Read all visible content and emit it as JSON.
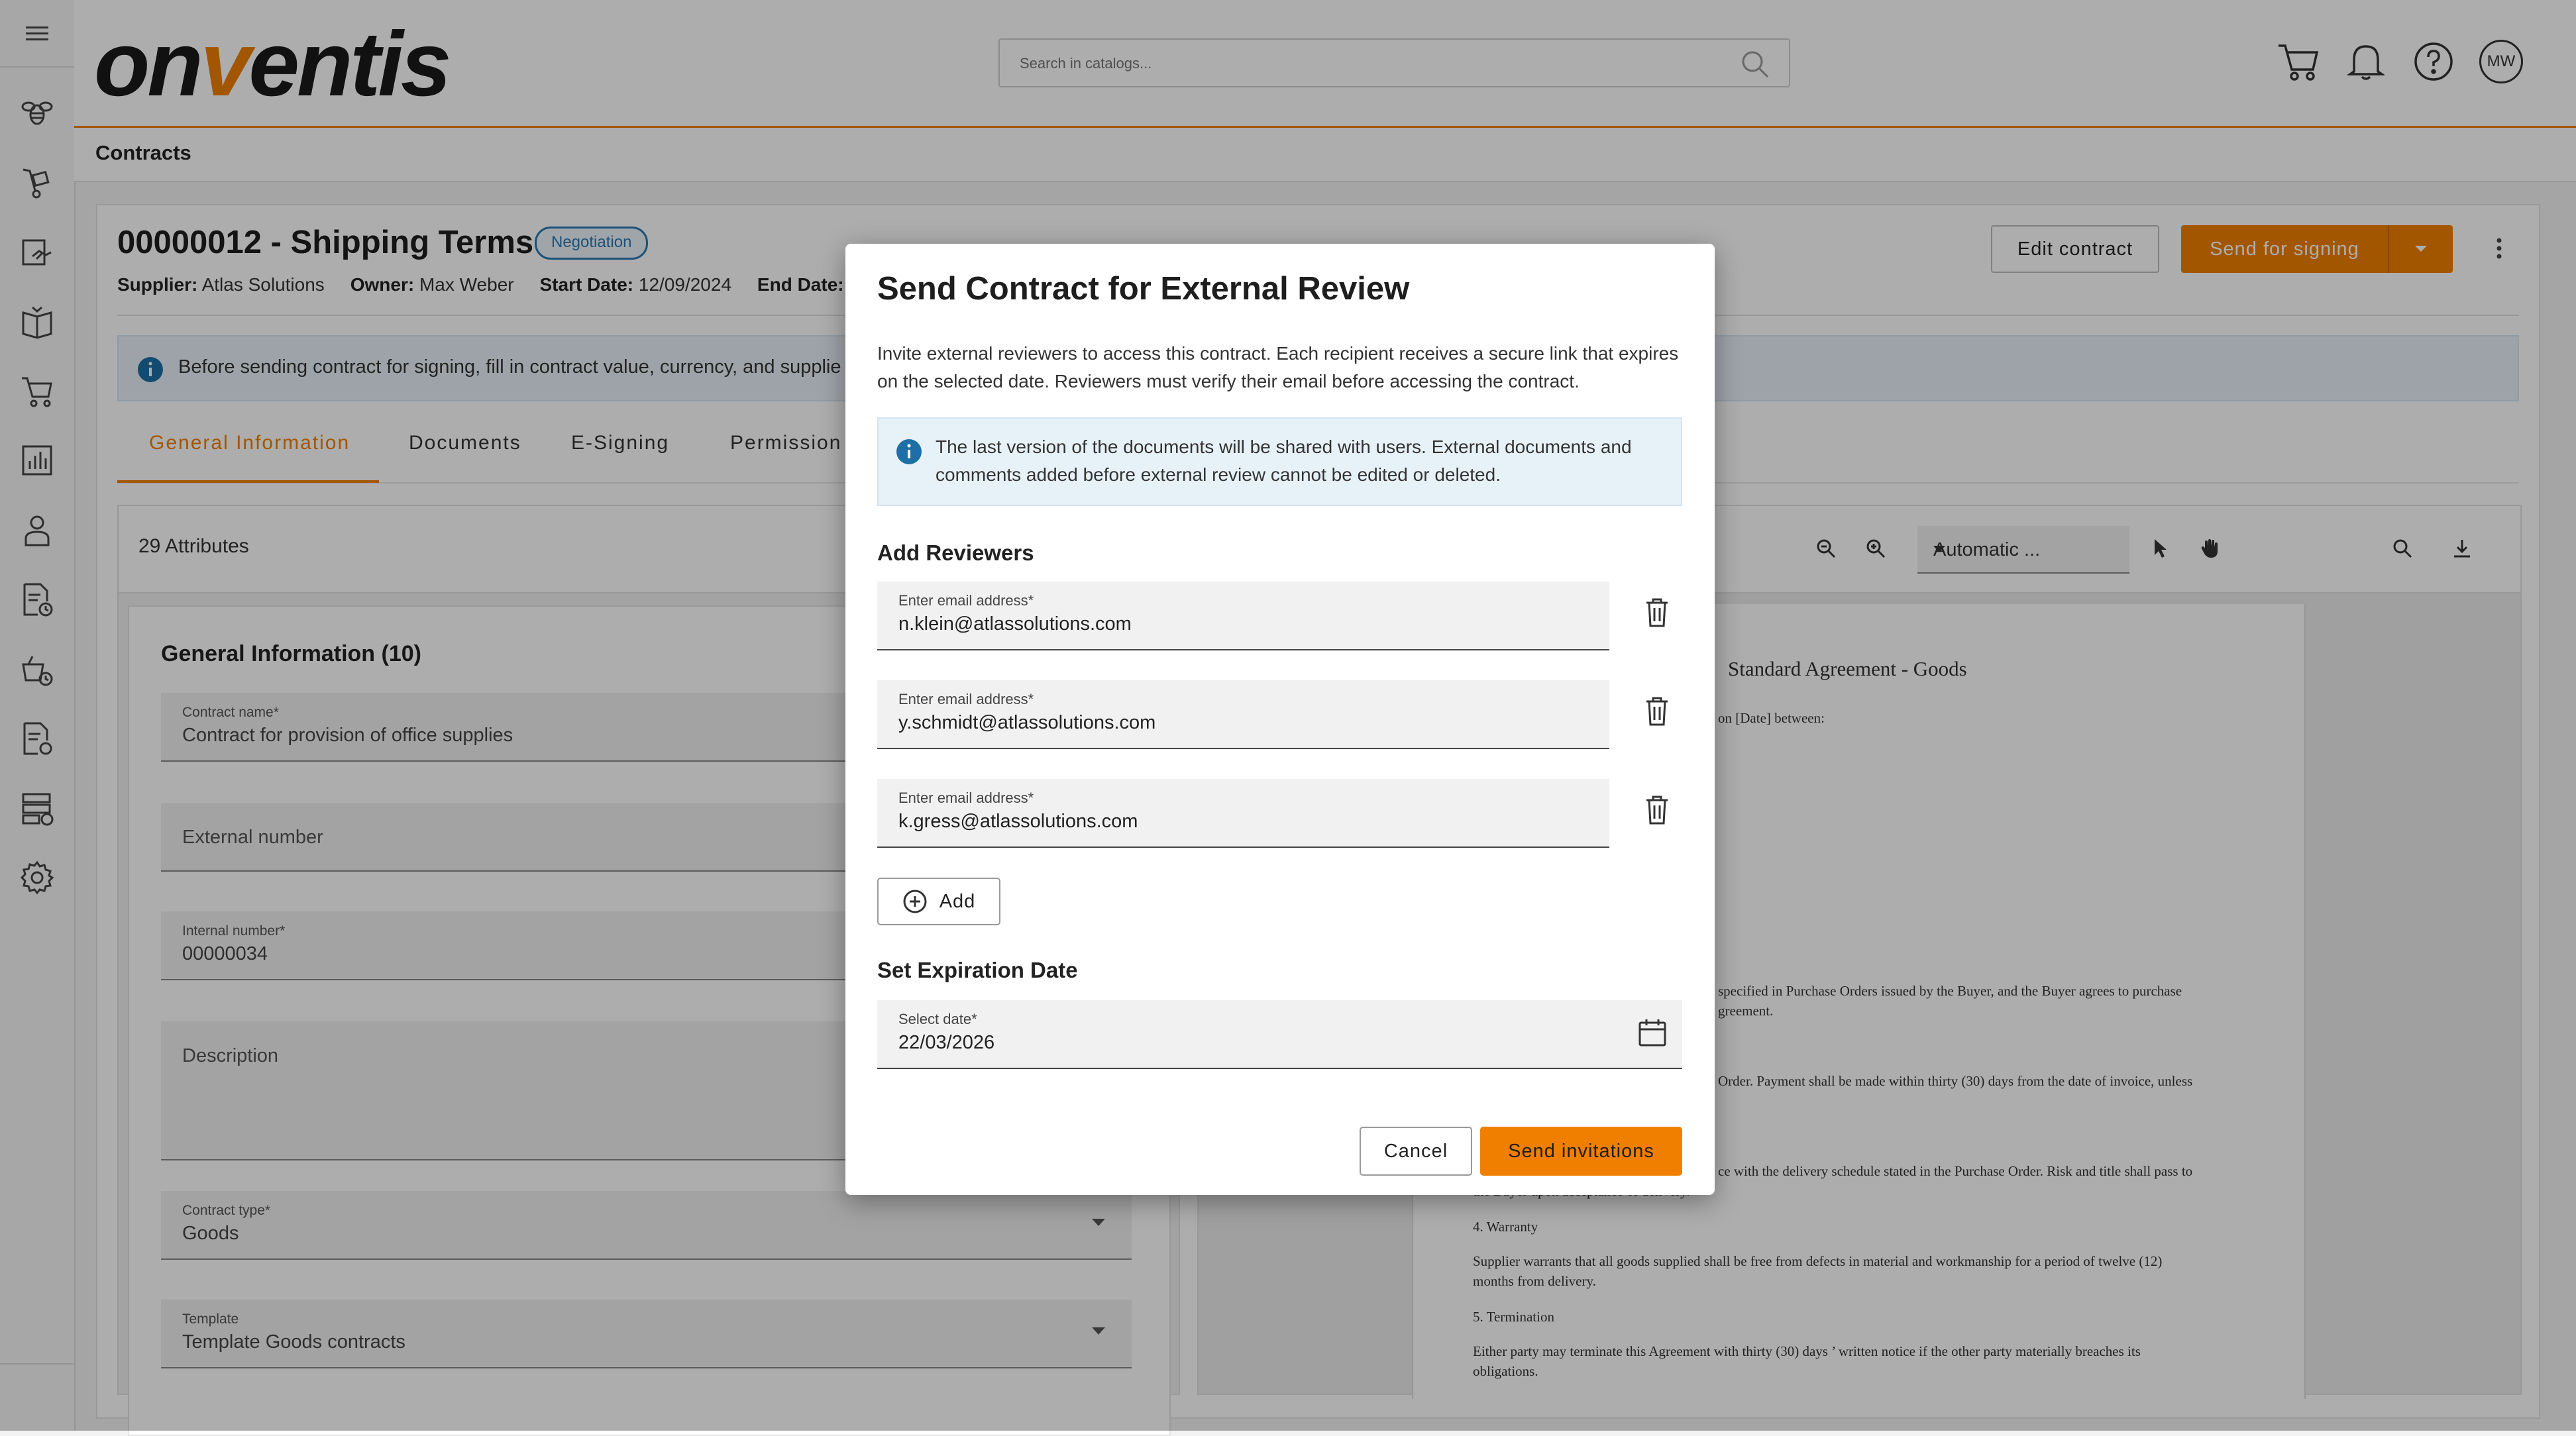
{
  "header": {
    "logo_prefix": "on",
    "logo_v": "v",
    "logo_suffix": "entis",
    "search_placeholder": "Search in catalogs...",
    "avatar_initials": "MW"
  },
  "breadcrumb": "Contracts",
  "contract": {
    "title": "00000012 - Shipping Terms",
    "status": "Negotiation",
    "supplier_label": "Supplier:",
    "supplier": "Atlas Solutions",
    "owner_label": "Owner:",
    "owner": "Max Weber",
    "start_label": "Start Date:",
    "start": "12/09/2024",
    "end_label": "End Date:",
    "edit_button": "Edit contract",
    "sign_button": "Send for signing",
    "info_text": "Before sending contract for signing, fill in contract value, currency, and supplie"
  },
  "tabs": [
    "General Information",
    "Documents",
    "E-Signing",
    "Permission"
  ],
  "attributes": {
    "count_label": "29 Attributes",
    "section_title": "General Information (10)",
    "fields": [
      {
        "label": "Contract name*",
        "value": "Contract for provision of office supplies"
      },
      {
        "label": "",
        "placeholder": "External number"
      },
      {
        "label": "Internal number*",
        "value": "00000034"
      },
      {
        "label": "",
        "placeholder": "Description"
      },
      {
        "label": "Contract type*",
        "value": "Goods"
      },
      {
        "label": "Template",
        "value": "Template Goods contracts"
      }
    ]
  },
  "viewer": {
    "zoom": "Automatic ...",
    "doc_title": "Standard Agreement - Goods",
    "doc_lines": [
      "on [Date] between:",
      "specified in Purchase Orders issued by the Buyer, and the Buyer agrees to purchase",
      "greement.",
      "Order. Payment shall be made within thirty (30) days from the date of invoice, unless",
      "ce with the delivery schedule stated in the Purchase Order. Risk and title shall pass to",
      "the Buyer upon acceptance of delivery.",
      "4. Warranty",
      "Supplier warrants that all goods supplied shall be free from defects in material and workmanship for a period of twelve (12)",
      "months from delivery.",
      "5. Termination",
      "Either party may terminate this Agreement with thirty (30) days ’ written notice if the other party materially breaches its",
      "obligations."
    ]
  },
  "modal": {
    "title": "Send Contract for External Review",
    "description": "Invite external reviewers to access this contract. Each recipient receives a secure link that expires on the selected date. Reviewers must verify their email before accessing the contract.",
    "info": "The last version of the documents will be shared with users. External documents and comments added before external review cannot be edited or deleted.",
    "reviewers_heading": "Add Reviewers",
    "email_label": "Enter email address*",
    "emails": [
      "n.klein@atlassolutions.com",
      "y.schmidt@atlassolutions.com",
      "k.gress@atlassolutions.com"
    ],
    "add_button": "Add",
    "expiration_heading": "Set Expiration Date",
    "date_label": "Select date*",
    "date_value": "22/03/2026",
    "cancel_button": "Cancel",
    "send_button": "Send invitations"
  }
}
